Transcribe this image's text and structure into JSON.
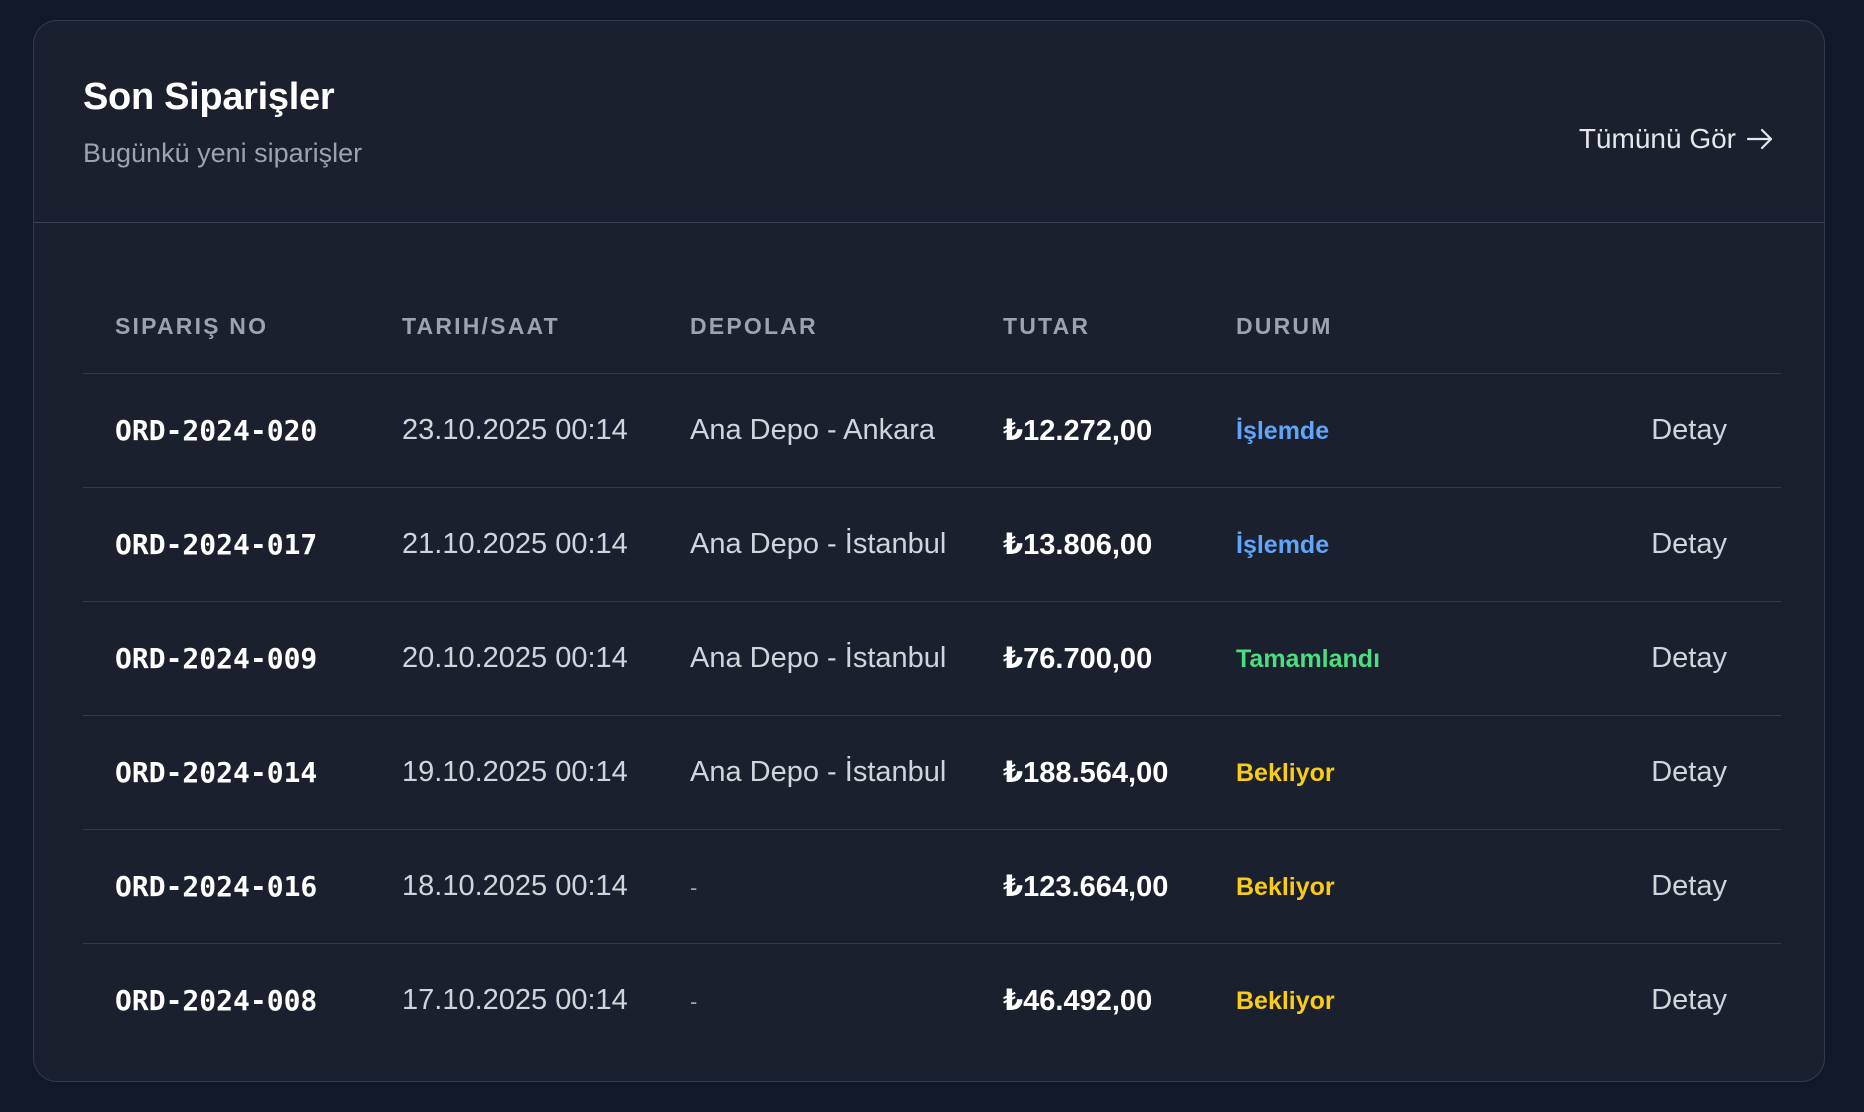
{
  "header": {
    "title": "Son Siparişler",
    "subtitle": "Bugünkü yeni siparişler",
    "view_all_label": "Tümünü Gör",
    "view_all_icon": "arrow-right-icon"
  },
  "table": {
    "columns": [
      "SIPARIŞ NO",
      "TARIH/SAAT",
      "DEPOLAR",
      "TUTAR",
      "DURUM",
      ""
    ],
    "rows": [
      {
        "order_no": "ORD-2024-020",
        "datetime": "23.10.2025 00:14",
        "depot": "Ana Depo - Ankara",
        "amount": "₺12.272,00",
        "status": "İşlemde",
        "status_color": "#60a5fa",
        "action": "Detay"
      },
      {
        "order_no": "ORD-2024-017",
        "datetime": "21.10.2025 00:14",
        "depot": "Ana Depo - İstanbul",
        "amount": "₺13.806,00",
        "status": "İşlemde",
        "status_color": "#60a5fa",
        "action": "Detay"
      },
      {
        "order_no": "ORD-2024-009",
        "datetime": "20.10.2025 00:14",
        "depot": "Ana Depo - İstanbul",
        "amount": "₺76.700,00",
        "status": "Tamamlandı",
        "status_color": "#4ade80",
        "action": "Detay"
      },
      {
        "order_no": "ORD-2024-014",
        "datetime": "19.10.2025 00:14",
        "depot": "Ana Depo - İstanbul",
        "amount": "₺188.564,00",
        "status": "Bekliyor",
        "status_color": "#facc15",
        "action": "Detay"
      },
      {
        "order_no": "ORD-2024-016",
        "datetime": "18.10.2025 00:14",
        "depot": "-",
        "amount": "₺123.664,00",
        "status": "Bekliyor",
        "status_color": "#facc15",
        "action": "Detay"
      },
      {
        "order_no": "ORD-2024-008",
        "datetime": "17.10.2025 00:14",
        "depot": "-",
        "amount": "₺46.492,00",
        "status": "Bekliyor",
        "status_color": "#facc15",
        "action": "Detay"
      }
    ]
  },
  "colors": {
    "background": "#111827",
    "card": "#1a202e",
    "processing": "#60a5fa",
    "completed": "#4ade80",
    "pending": "#facc15"
  }
}
